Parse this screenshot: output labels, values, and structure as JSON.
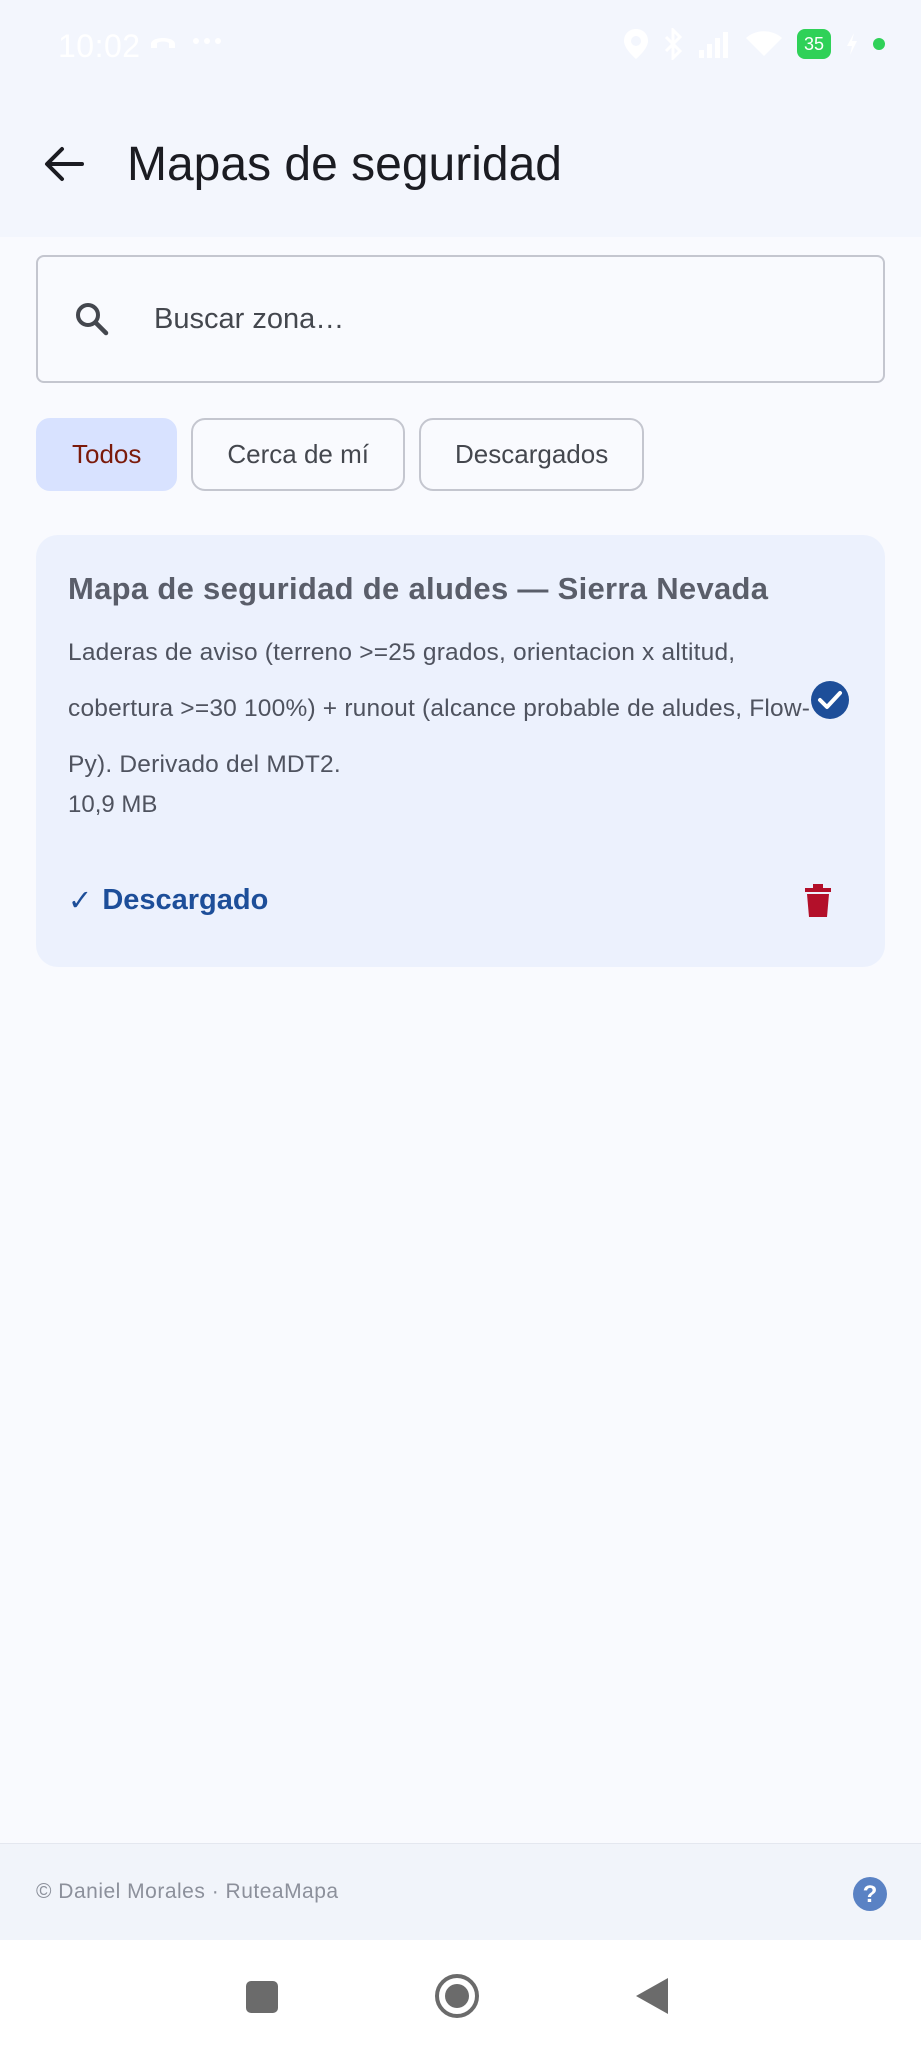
{
  "status_bar": {
    "time": "10:02",
    "battery": "35"
  },
  "app_bar": {
    "title": "Mapas de seguridad"
  },
  "search": {
    "placeholder": "Buscar zona…"
  },
  "filters": [
    {
      "label": "Todos",
      "active": true
    },
    {
      "label": "Cerca de mí",
      "active": false
    },
    {
      "label": "Descargados",
      "active": false
    }
  ],
  "card": {
    "title": "Mapa de seguridad de aludes — Sierra Nevada",
    "description": "Laderas de aviso (terreno >=25 grados, orientacion x altitud, cobertura >=30 100%) + runout (alcance probable de aludes, Flow-Py). Derivado del MDT2.",
    "size": "10,9 MB",
    "status": "Descargado"
  },
  "footer": {
    "text": "© Daniel Morales · RuteaMapa"
  },
  "colors": {
    "accent": "#1d4e99",
    "chip_active_bg": "#d8e2ff",
    "delete": "#b3102a",
    "battery": "#2fd158"
  }
}
